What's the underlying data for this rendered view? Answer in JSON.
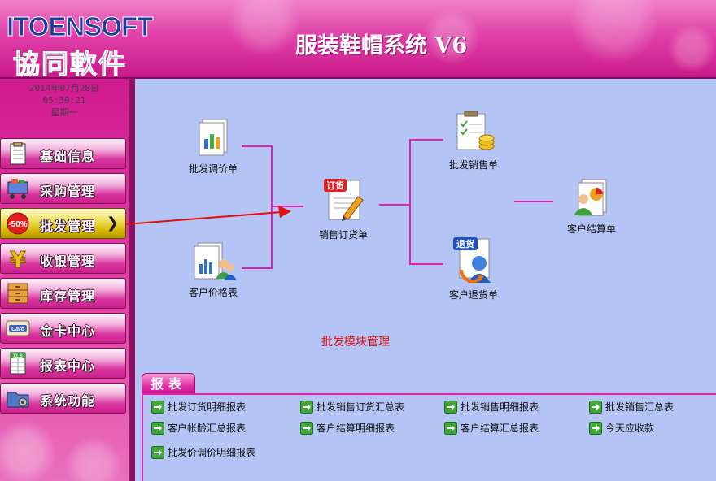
{
  "header": {
    "logo_en": "ITOENSOFT",
    "logo_cn": "協同軟件",
    "app_title": "服装鞋帽系统 V6"
  },
  "sidebar": {
    "date": "2014年07月28日",
    "time": "05:39:21",
    "weekday": "星期一",
    "items": [
      {
        "label": "基础信息",
        "icon": "clipboard-icon"
      },
      {
        "label": "采购管理",
        "icon": "shopping-cart-icon"
      },
      {
        "label": "批发管理",
        "icon": "discount-tag-icon",
        "badge": "-50%",
        "active": true
      },
      {
        "label": "收银管理",
        "icon": "yen-icon"
      },
      {
        "label": "库存管理",
        "icon": "cabinet-icon"
      },
      {
        "label": "金卡中心",
        "icon": "card-icon",
        "badge": "Card"
      },
      {
        "label": "报表中心",
        "icon": "spreadsheet-icon",
        "badge": "XLS"
      },
      {
        "label": "系统功能",
        "icon": "settings-folder-icon"
      }
    ]
  },
  "flow": {
    "wholesale_price_adjust": "批发调价单",
    "customer_price_list": "客户价格表",
    "sales_order": "销售订货单",
    "wholesale_sales": "批发销售单",
    "customer_return": "客户退货单",
    "customer_settlement": "客户结算单",
    "order_badge": "订货",
    "return_badge": "退货",
    "module_title": "批发模块管理"
  },
  "reports": {
    "tab_label": "报表",
    "links": [
      "批发订货明细报表",
      "批发销售订货汇总表",
      "批发销售明细报表",
      "批发销售汇总表",
      "客户帐龄汇总报表",
      "客户结算明细报表",
      "客户结算汇总报表",
      "今天应收款",
      "批发价调价明细报表"
    ]
  },
  "colors": {
    "header_pink": "#e040a8",
    "main_bg": "#b4c4f4",
    "connector": "#e020b0",
    "arrow": "#e01010",
    "module_title": "#e01010"
  }
}
